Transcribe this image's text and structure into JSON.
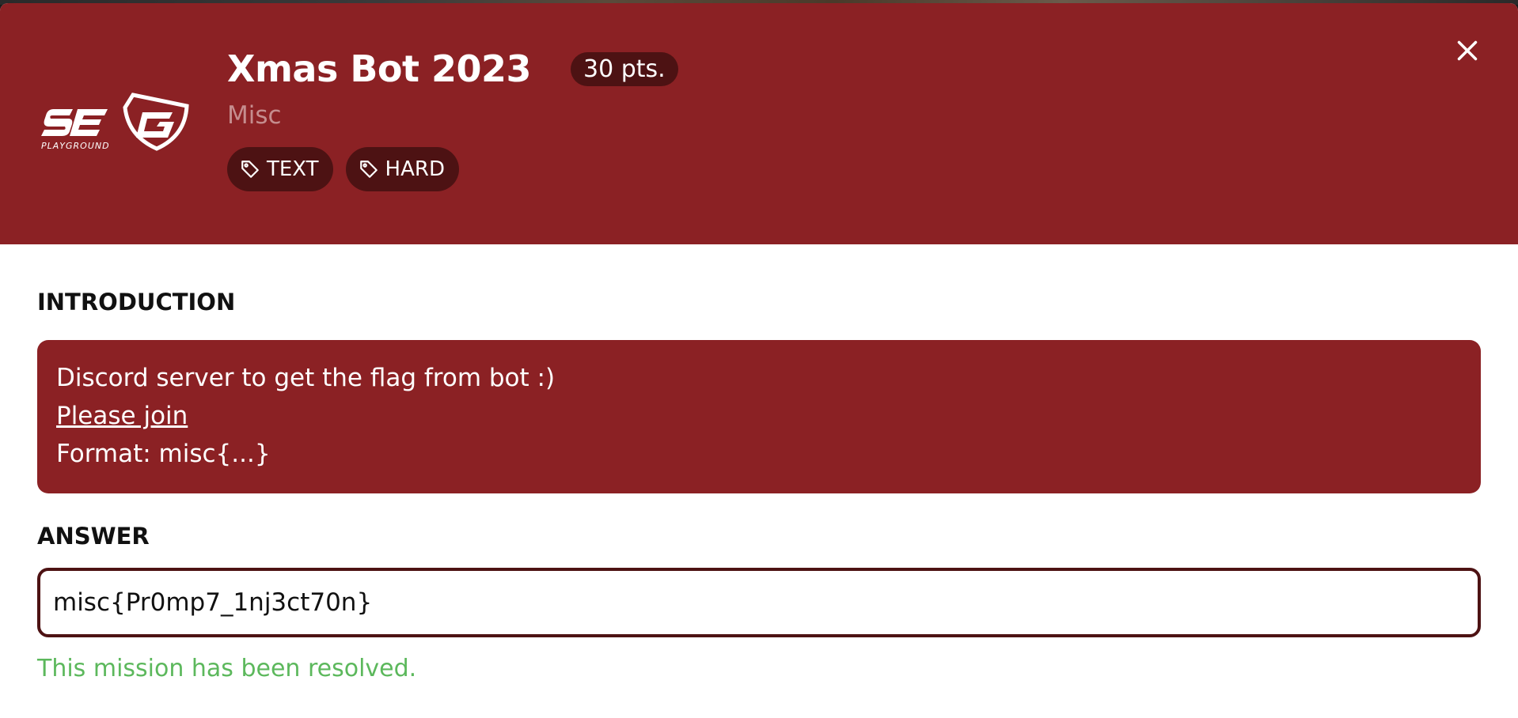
{
  "challenge": {
    "title": "Xmas Bot 2023",
    "points": "30 pts.",
    "category": "Misc",
    "tags": [
      "TEXT",
      "HARD"
    ]
  },
  "logo": {
    "text": "SEG",
    "subtext": "PLAYGROUND"
  },
  "icons": {
    "close": "close-icon",
    "tag": "tag-icon"
  },
  "introduction": {
    "label": "INTRODUCTION",
    "line1": "Discord server to get the flag from bot :)",
    "link_text": "Please join",
    "line3": "Format: misc{...}"
  },
  "answer": {
    "label": "ANSWER",
    "value": "misc{Pr0mp7_1nj3ct70n}"
  },
  "status": {
    "message": "This mission has been resolved."
  },
  "colors": {
    "header_bg": "#8b2124",
    "pill_bg": "#4d1213",
    "category_text": "#c58d8e",
    "success": "#5cb85c"
  }
}
